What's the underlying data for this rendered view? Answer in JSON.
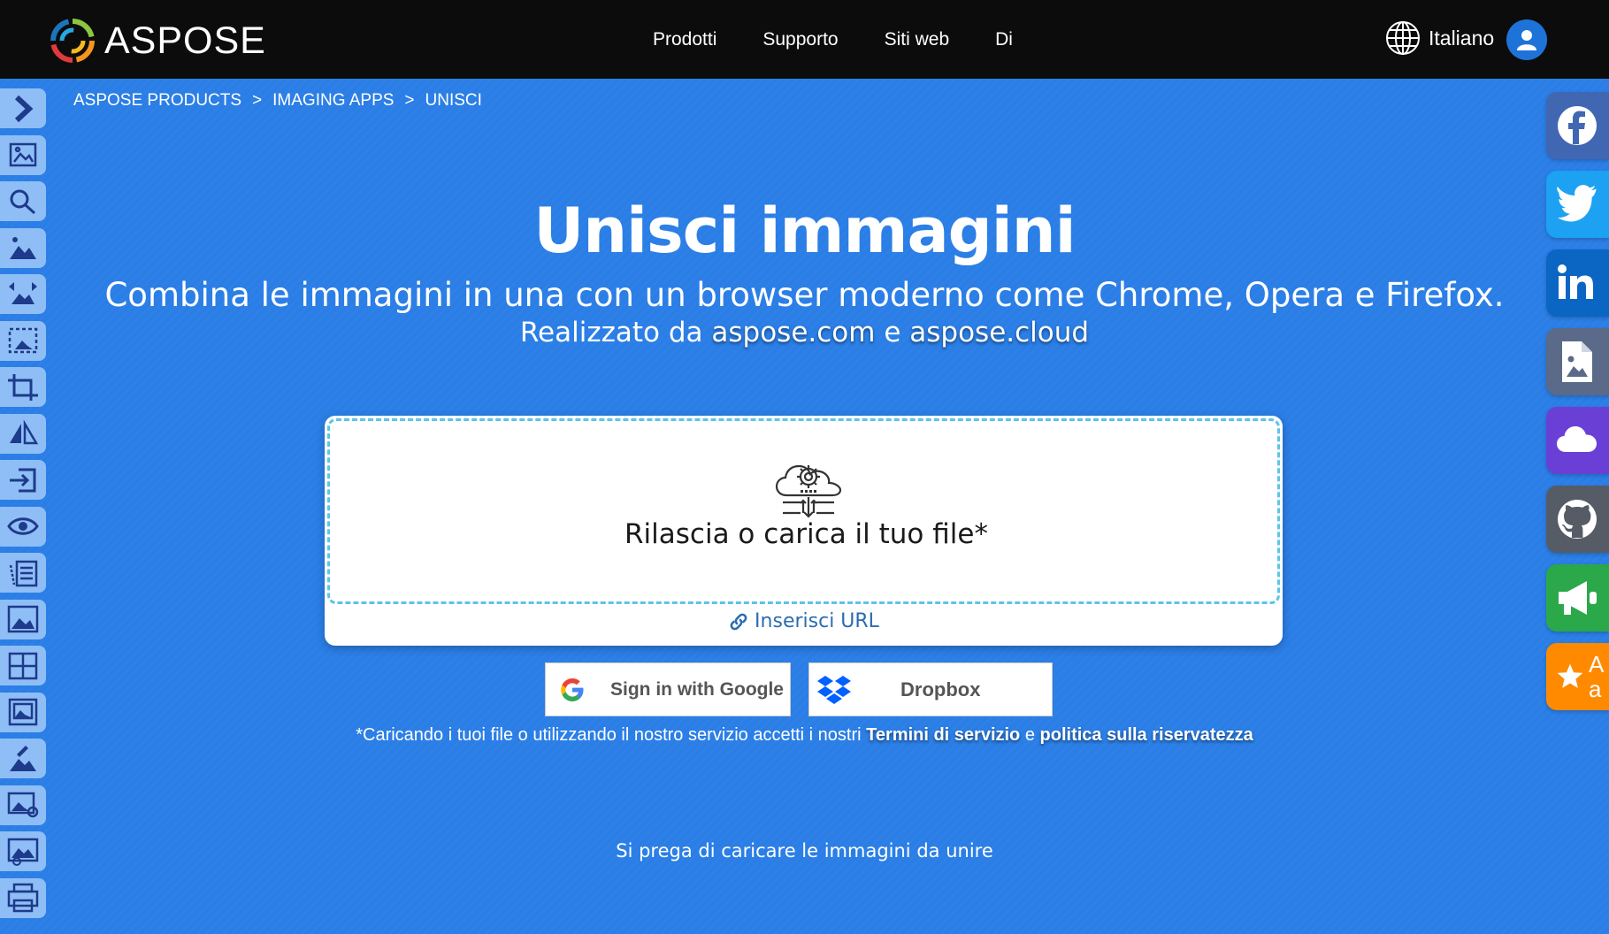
{
  "header": {
    "logo_text": "ASPOSE",
    "nav": [
      "Prodotti",
      "Supporto",
      "Siti web",
      "Di"
    ],
    "language": "Italiano"
  },
  "breadcrumb": [
    "ASPOSE PRODUCTS",
    ">",
    "IMAGING APPS",
    ">",
    "UNISCI"
  ],
  "hero": {
    "title": "Unisci immagini",
    "subtitle": "Combina le immagini in una con un browser moderno come Chrome, Opera e Firefox.",
    "by_prefix": "Realizzato da",
    "by_link1": "aspose.com",
    "by_and": "e",
    "by_link2": "aspose.cloud"
  },
  "upload": {
    "drop_label": "Rilascia o carica il tuo file*",
    "url_label": "Inserisci URL"
  },
  "buttons": {
    "google": "Sign in with Google",
    "dropbox": "Dropbox"
  },
  "terms": {
    "prefix": "*Caricando i tuoi file o utilizzando il nostro servizio accetti i nostri",
    "tos": "Termini di servizio",
    "and": "e",
    "privacy": "politica sulla riservatezza"
  },
  "hint": "Si prega di caricare le immagini da unire",
  "social": {
    "feedback_text_1": "A",
    "feedback_text_2": "a"
  },
  "colors": {
    "page_bg": "#2a7ee6",
    "header_bg": "#0c0c0c",
    "sidebar_item": "#8fbef6",
    "facebook": "#4267b2",
    "twitter": "#1da1f2",
    "linkedin": "#0a66c2",
    "document": "#5a6a88",
    "cloud": "#6a3fd6",
    "github": "#555c66",
    "announce": "#2aa84a",
    "feedback": "#ff8a00",
    "dropzone_border": "#5bc5e6",
    "url_link": "#2b6cb0"
  }
}
